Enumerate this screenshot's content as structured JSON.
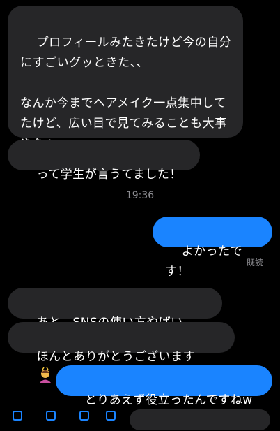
{
  "messages": {
    "m1": "プロフィールみたきたけど今の自分にすごいグッときた、、\n\nなんか今までヘアメイク一点集中してたけど、広い目で見てみることも大事やなぁ、、",
    "m2": "って学生が言うてました！",
    "time": "19:36",
    "m3": "よかったです！",
    "read": "既読",
    "m4": "あと、SNSの使い方やばい",
    "m5": "ほんとありがとうございます",
    "m6": "とりあえず役立ったんですねw"
  },
  "colors": {
    "incoming": "#262628",
    "outgoing": "#1a84ff",
    "meta": "#8e8e93"
  },
  "icons": [
    "tears-of-joy-emoji",
    "bowing-person-emoji"
  ]
}
